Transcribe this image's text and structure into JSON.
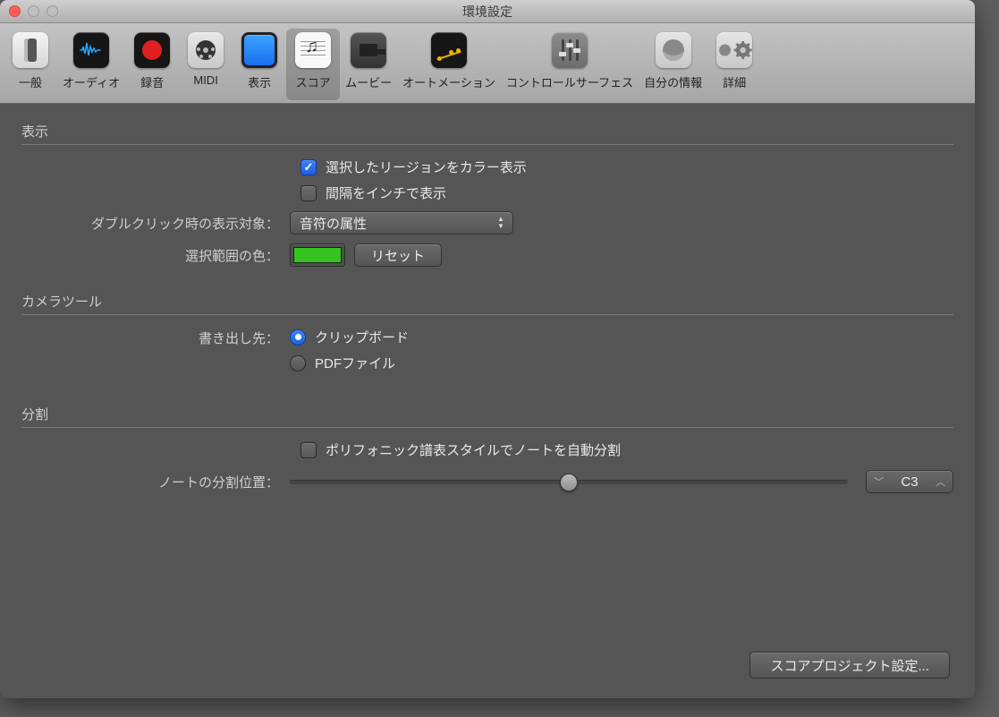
{
  "window": {
    "title": "環境設定"
  },
  "toolbar": {
    "items": [
      {
        "id": "general",
        "label": "一般"
      },
      {
        "id": "audio",
        "label": "オーディオ"
      },
      {
        "id": "record",
        "label": "録音"
      },
      {
        "id": "midi",
        "label": "MIDI"
      },
      {
        "id": "display",
        "label": "表示"
      },
      {
        "id": "score",
        "label": "スコア"
      },
      {
        "id": "movie",
        "label": "ムービー"
      },
      {
        "id": "automation",
        "label": "オートメーション"
      },
      {
        "id": "surface",
        "label": "コントロールサーフェス"
      },
      {
        "id": "myinfo",
        "label": "自分の情報"
      },
      {
        "id": "advanced",
        "label": "詳細"
      }
    ],
    "selected": "score"
  },
  "sections": {
    "display": {
      "title": "表示",
      "color_regions": {
        "label": "選択したリージョンをカラー表示",
        "checked": true
      },
      "inches": {
        "label": "間隔をインチで表示",
        "checked": false
      },
      "doubleclick": {
        "label": "ダブルクリック時の表示対象：",
        "value": "音符の属性"
      },
      "selection_color": {
        "label": "選択範囲の色：",
        "color": "#35c31f",
        "reset_label": "リセット"
      }
    },
    "camera": {
      "title": "カメラツール",
      "export_label": "書き出し先：",
      "options": {
        "clipboard": {
          "label": "クリップボード",
          "checked": true
        },
        "pdf": {
          "label": "PDFファイル",
          "checked": false
        }
      }
    },
    "split": {
      "title": "分割",
      "auto_split": {
        "label": "ポリフォニック譜表スタイルでノートを自動分割",
        "checked": false
      },
      "split_point": {
        "label": "ノートの分割位置：",
        "value": "C3",
        "slider_percent": 50
      }
    }
  },
  "footer": {
    "project_settings": "スコアプロジェクト設定..."
  }
}
